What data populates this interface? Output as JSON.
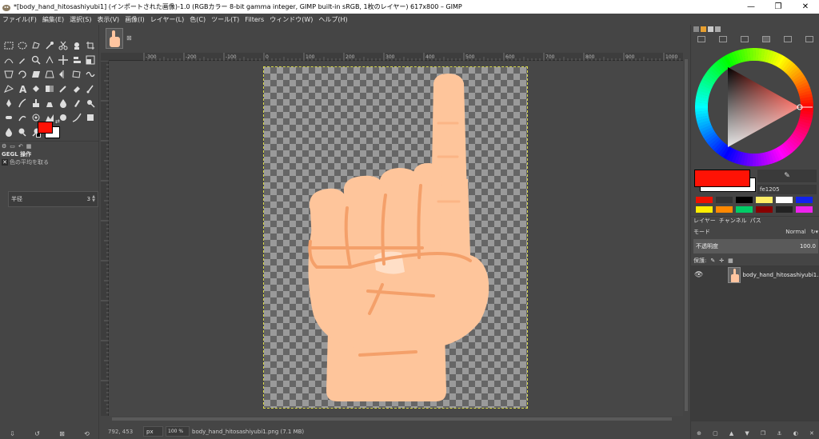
{
  "window": {
    "title": "*[body_hand_hitosashiyubi1] (インポートされた画像)-1.0 (RGBカラー 8-bit gamma integer, GIMP built-in sRGB, 1枚のレイヤー) 617x800 – GIMP",
    "minimize": "—",
    "maximize": "❐",
    "close": "✕"
  },
  "menu": [
    "ファイル(F)",
    "編集(E)",
    "選択(S)",
    "表示(V)",
    "画像(I)",
    "レイヤー(L)",
    "色(C)",
    "ツール(T)",
    "Filters",
    "ウィンドウ(W)",
    "ヘルプ(H)"
  ],
  "toolbox": {
    "fg_color": "#fe1205",
    "bg_color": "#ffffff",
    "options_title": "GEGL 操作",
    "operation_placeholder": "色の平均を取る",
    "radius_label": "半径",
    "radius_value": "3",
    "bottom_icons": [
      "save-icon",
      "restore-icon",
      "delete-icon",
      "reset-icon"
    ]
  },
  "canvas": {
    "image_tab_close": "⊠",
    "ruler_labels": [
      "-400",
      "-300",
      "-200",
      "-100",
      "0",
      "100",
      "200",
      "300",
      "400",
      "500",
      "600",
      "700",
      "800",
      "900",
      "1000"
    ]
  },
  "status": {
    "coords": "792, 453",
    "unit": "px",
    "zoom": "100 %",
    "file": "body_hand_hitosashiyubi1.png (7.1 MB)"
  },
  "dock": {
    "hex_value": "fe1205",
    "picker_icon": "✎",
    "palette": [
      "#ee1100",
      "#333333",
      "#000000",
      "#ffee66",
      "#ffffff",
      "#1122ee",
      "#ffee00",
      "#ff8800",
      "#00cc66",
      "#880000",
      "#222222",
      "#ee22ee"
    ],
    "layers_tabs": [
      "レイヤー",
      "チャンネル",
      "パス"
    ],
    "mode_label": "モード",
    "mode_value": "Normal",
    "opacity_label": "不透明度",
    "opacity_value": "100.0",
    "lock_label": "保護:",
    "layer_name": "body_hand_hitosashiyubi1.png"
  }
}
